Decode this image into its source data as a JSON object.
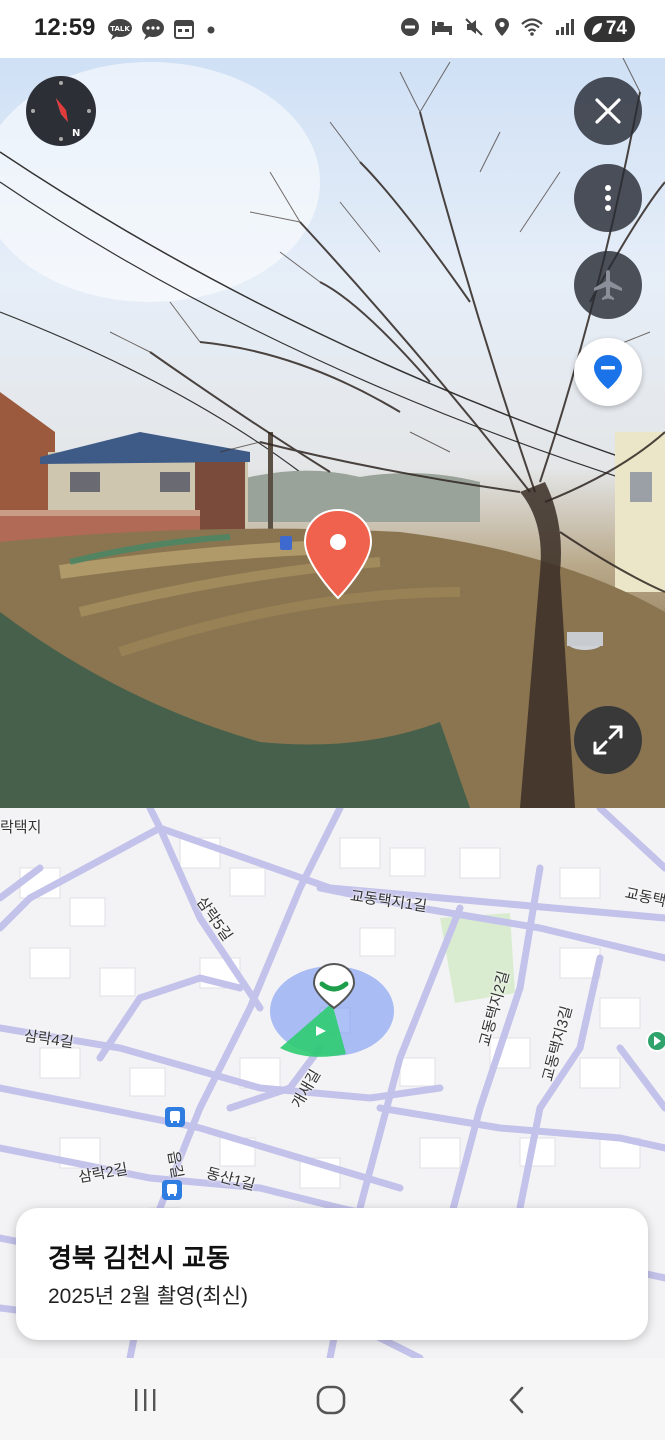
{
  "status_bar": {
    "time": "12:59",
    "battery": "74",
    "left_icons": [
      "talk-icon",
      "message-icon",
      "calendar-icon",
      "dot-icon"
    ],
    "right_icons": [
      "dnd-icon",
      "sleep-icon",
      "mute-icon",
      "location-icon",
      "wifi-icon",
      "signal-icon",
      "battery-icon"
    ]
  },
  "panorama": {
    "buttons": [
      "compass-icon",
      "close-icon",
      "more-icon",
      "airplane-icon",
      "pin-toggle-icon",
      "expand-icon"
    ],
    "marker_color": "#f0624d"
  },
  "map": {
    "labels": {
      "taekji": "락택지",
      "gyodong_taekji_1gil_a": "교동택지1길",
      "gyodong_taekji_1gil_b": "교동택",
      "samrak_5gil": "삼락5길",
      "samrak_4gil": "삼락4길",
      "gaesaegil": "개새길",
      "gyodong_taekji_2gil": "교동택지2길",
      "gyodong_taekji_3gil": "교동택지3길",
      "samrak_2gil": "삼락2길",
      "dongsan_1gil": "동산1길",
      "gil_short": "읍길"
    },
    "road_color": "#c3c2ea",
    "park_color": "#d9ecd0"
  },
  "card": {
    "title": "경북 김천시 교동",
    "subtitle": "2025년 2월 촬영(최신)"
  },
  "navbar": {
    "buttons": [
      "recent-apps-icon",
      "home-icon",
      "back-icon"
    ]
  }
}
